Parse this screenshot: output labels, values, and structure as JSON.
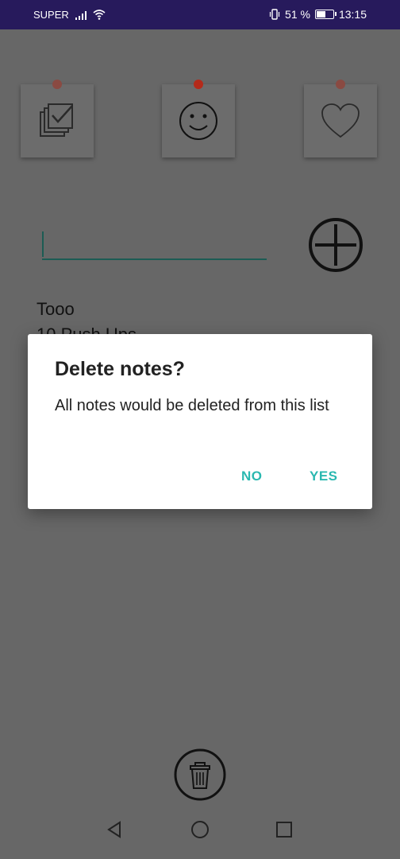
{
  "status": {
    "carrier": "SUPER",
    "battery": "51 %",
    "time": "13:15"
  },
  "notes_input": {
    "value": ""
  },
  "list_items": [
    "Tooo",
    "10 Push Ups"
  ],
  "dialog": {
    "title": "Delete notes?",
    "message": "All notes would be deleted from this list",
    "no_label": "NO",
    "yes_label": "YES",
    "accent_color": "#2ab8b0"
  },
  "icons": {
    "tab1": "checklist-icon",
    "tab2": "smiley-icon",
    "tab3": "heart-icon",
    "add": "plus-circle-icon",
    "delete": "trash-icon",
    "nav_back": "back-triangle-icon",
    "nav_home": "home-circle-icon",
    "nav_recent": "recents-square-icon"
  }
}
